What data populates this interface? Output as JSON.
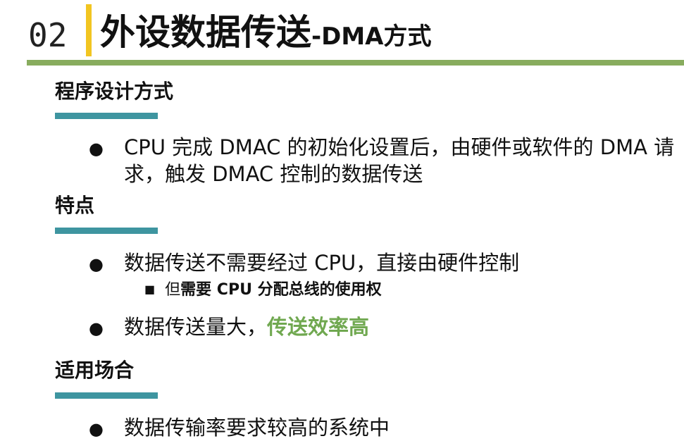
{
  "header": {
    "number": "02",
    "title_main": "外设数据传送",
    "title_sep": "-",
    "title_sub": "DMA方式"
  },
  "colors": {
    "accent_yellow": "#f2c521",
    "header_line_green": "#88ac5e",
    "section_bar_teal": "#3e95a0",
    "highlight_green": "#70a850"
  },
  "sections": [
    {
      "heading": "程序设计方式",
      "bullets": [
        {
          "text": "CPU 完成 DMAC 的初始化设置后，由硬件或软件的 DMA 请求，触发 DMAC 控制的数据传送"
        }
      ]
    },
    {
      "heading": "特点",
      "bullets": [
        {
          "text": "数据传送不需要经过 CPU，直接由硬件控制",
          "sub_prefix": "但",
          "sub_bold": "需要 CPU 分配总线的使用权"
        },
        {
          "text": "数据传送量大，",
          "highlight": "传送效率高"
        }
      ]
    },
    {
      "heading": "适用场合",
      "bullets": [
        {
          "text": "数据传输率要求较高的系统中"
        }
      ]
    }
  ],
  "icons": {
    "bullet": "●",
    "sub_bullet": "■"
  }
}
